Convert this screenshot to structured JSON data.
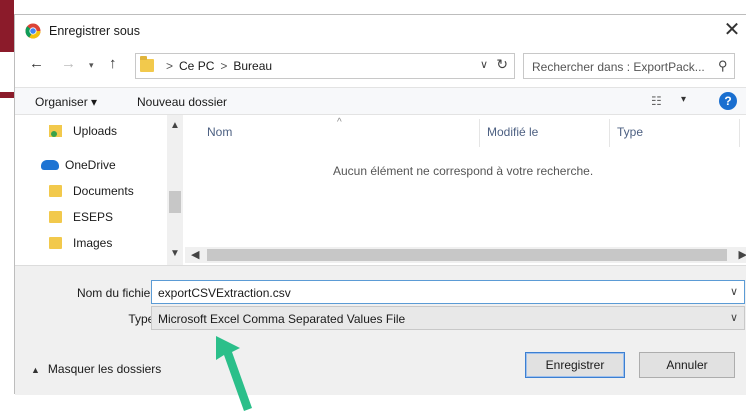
{
  "window": {
    "title": "Enregistrer sous",
    "close_glyph": "✕"
  },
  "navigation": {
    "back_glyph": "←",
    "forward_glyph": "→",
    "recent_glyph": "▾",
    "up_glyph": "↑",
    "breadcrumbs": [
      "Ce PC",
      "Bureau"
    ],
    "crumb_separator": ">",
    "dropdown_glyph": "∨",
    "refresh_glyph": "↻",
    "search_placeholder": "Rechercher dans : ExportPack...",
    "search_glyph": "⚲"
  },
  "toolbar": {
    "organize_label": "Organiser ▾",
    "new_folder_label": "Nouveau dossier",
    "view_glyph": "☷",
    "view_dropdown_glyph": "▾",
    "help_glyph": "?"
  },
  "nav_pane": {
    "items": [
      {
        "label": "Uploads",
        "icon": "uploads-folder-icon"
      },
      {
        "label": "OneDrive",
        "icon": "onedrive-cloud-icon"
      },
      {
        "label": "Documents",
        "icon": "folder-icon"
      },
      {
        "label": "ESEPS",
        "icon": "folder-icon"
      },
      {
        "label": "Images",
        "icon": "folder-icon"
      }
    ]
  },
  "content": {
    "columns": [
      "Nom",
      "Modifié le",
      "Type"
    ],
    "sort_glyph": "^",
    "empty_message": "Aucun élément ne correspond à votre recherche."
  },
  "form": {
    "filename_label": "Nom du fichier :",
    "filename_value": "exportCSVExtraction.csv",
    "type_label": "Type :",
    "type_value": "Microsoft Excel Comma Separated Values File",
    "dropdown_glyph": "∨"
  },
  "footer": {
    "toggle_folders_label": "Masquer les dossiers",
    "save_label": "Enregistrer",
    "cancel_label": "Annuler"
  },
  "colors": {
    "accent": "#1a6fd0",
    "annotation_arrow": "#2bbf8a",
    "background_app": "#8b1b2a"
  }
}
